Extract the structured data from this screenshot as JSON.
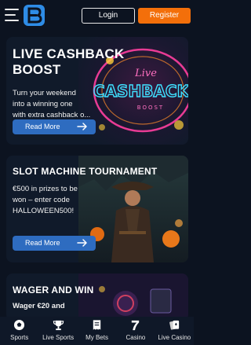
{
  "header": {
    "login_label": "Login",
    "register_label": "Register",
    "register_color": "#f36f0a",
    "logo_icon": "brand-b-logo"
  },
  "promos": [
    {
      "title_line1": "LIVE CASHBACK",
      "title_line2": "BOOST",
      "text_lines": [
        "Turn your weekend",
        "into a winning one",
        "with extra cashback o..."
      ],
      "cta_label": "Read More",
      "art_lines": [
        "Live",
        "CASHBACK",
        "BOOST"
      ]
    },
    {
      "title": "SLOT MACHINE TOURNAMENT",
      "text_lines": [
        "€500 in prizes to be",
        "won – enter code",
        "HALLOWEEN500!"
      ],
      "cta_label": "Read More"
    },
    {
      "title": "WAGER AND WIN",
      "text_lines": [
        "Wager €20 and"
      ]
    }
  ],
  "bottom_nav": [
    {
      "label": "Sports",
      "icon": "soccer-ball-icon"
    },
    {
      "label": "Live Sports",
      "icon": "trophy-icon"
    },
    {
      "label": "My Bets",
      "icon": "ticket-icon"
    },
    {
      "label": "Casino",
      "icon": "lucky-seven-icon"
    },
    {
      "label": "Live Casino",
      "icon": "playing-cards-icon"
    }
  ],
  "colors": {
    "background": "#0c1320",
    "cta": "#2e6cc0",
    "neon_pink": "#ff3fa0",
    "neon_cyan": "#3fe0ff"
  }
}
